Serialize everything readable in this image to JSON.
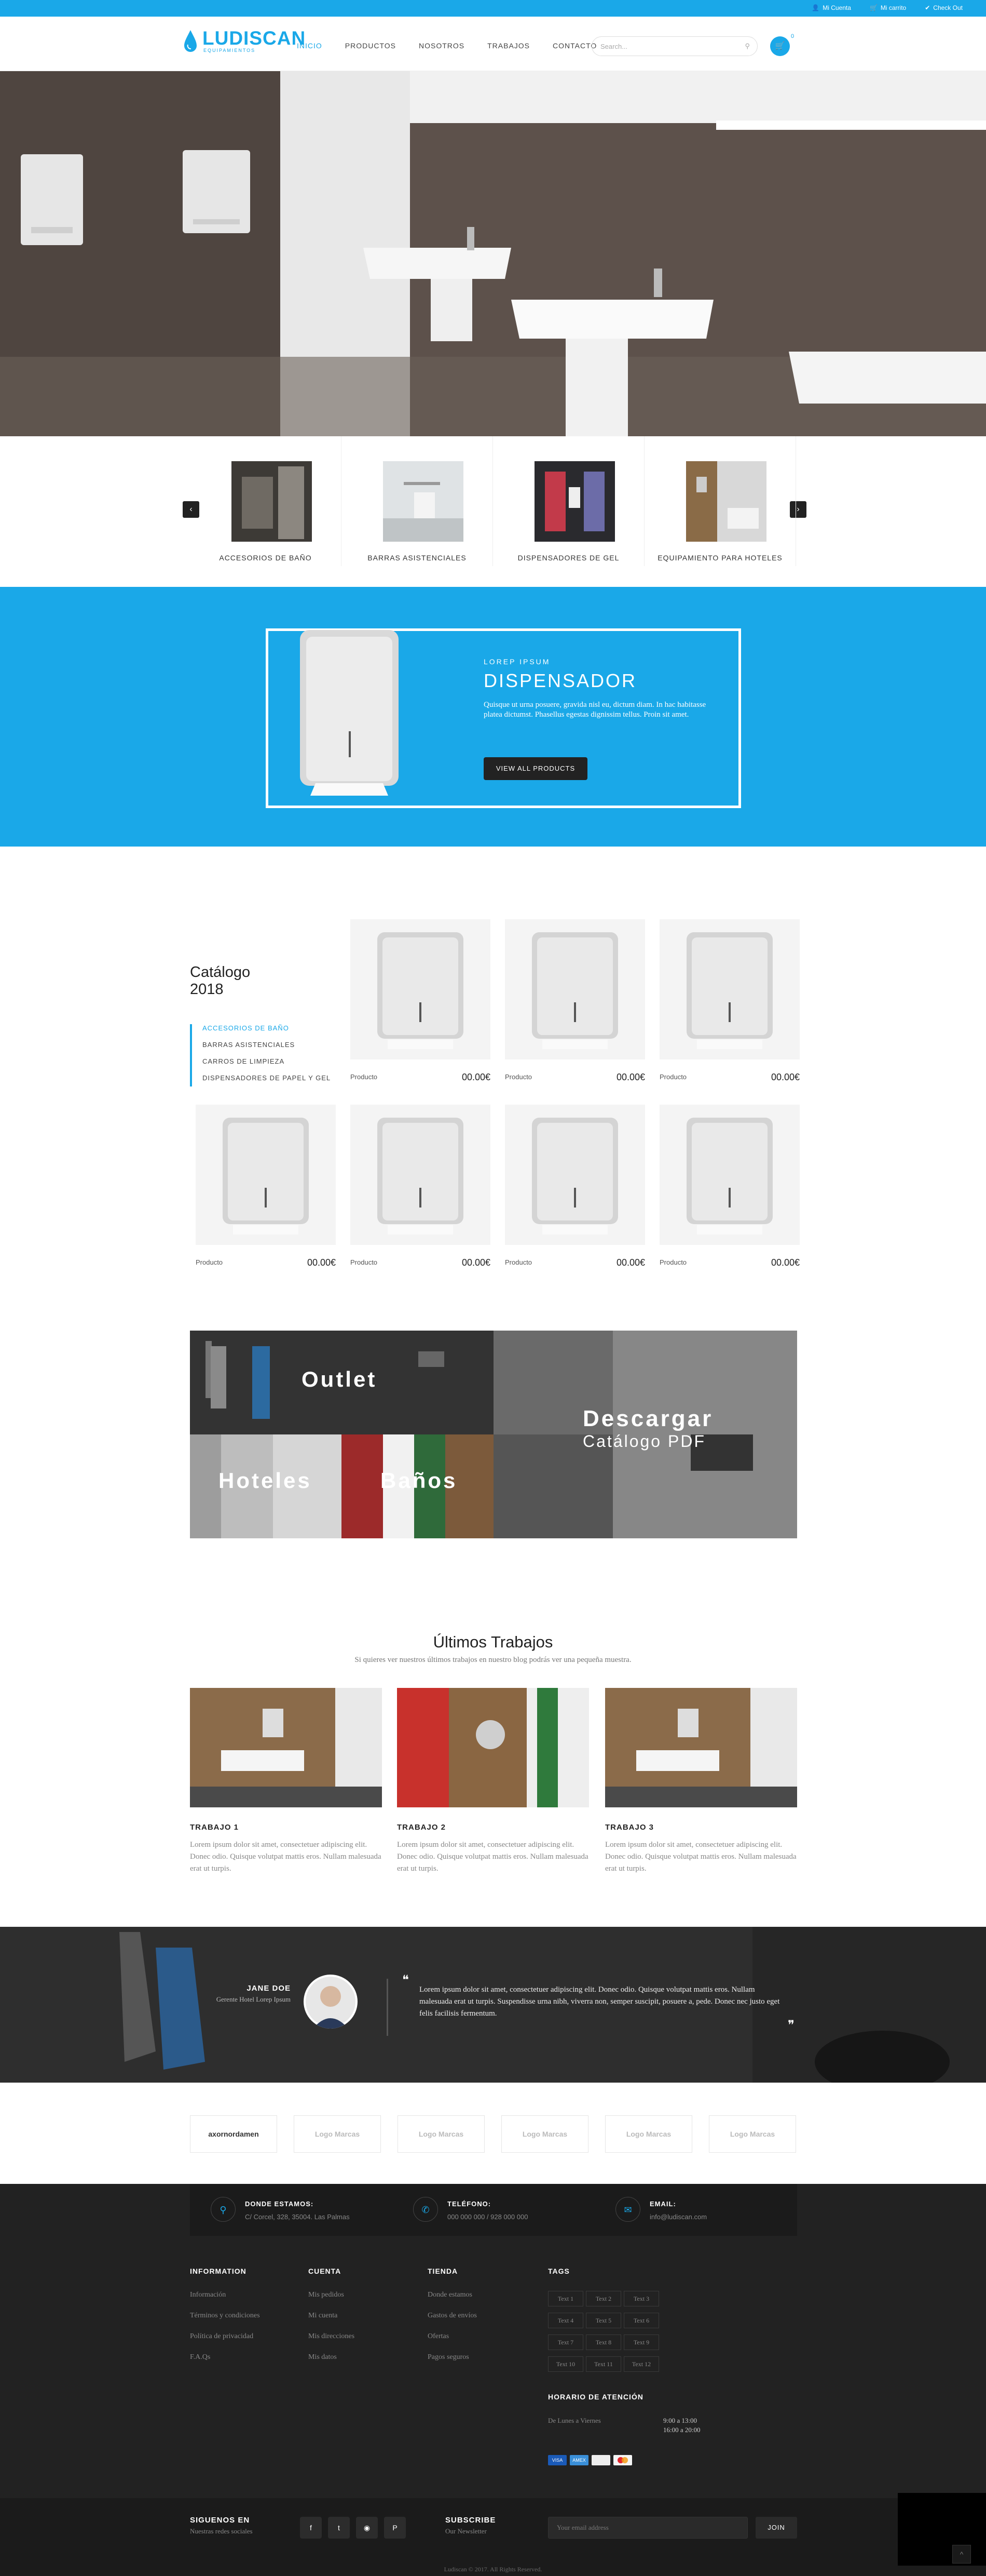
{
  "topbar": {
    "account": "Mi Cuenta",
    "cart": "Mi carrito",
    "checkout": "Check Out"
  },
  "header": {
    "logo_name": "LUDISCAN",
    "logo_sub": "EQUIPAMIENTOS",
    "nav": [
      "INICIO",
      "PRODUCTOS",
      "NOSOTROS",
      "TRABAJOS",
      "CONTACTO"
    ],
    "search_placeholder": "Search...",
    "cart_count": "0"
  },
  "categories": [
    "ACCESORIOS DE BAÑO",
    "BARRAS ASISTENCIALES",
    "DISPENSADORES DE GEL",
    "EQUIPAMIENTO PARA HOTELES"
  ],
  "promo": {
    "kicker": "LOREP IPSUM",
    "title": "DISPENSADOR",
    "text": "Quisque ut urna posuere, gravida nisl eu, dictum diam. In hac habitasse platea dictumst. Phasellus egestas dignissim tellus. Proin sit amet.",
    "button": "VIEW ALL PRODUCTS"
  },
  "catalog": {
    "title_line1": "Catálogo",
    "title_line2": "2018",
    "list": [
      "ACCESORIOS DE BAÑO",
      "BARRAS ASISTENCIALES",
      "CARROS DE LIMPIEZA",
      "DISPENSADORES DE PAPEL Y GEL"
    ],
    "products": [
      {
        "name": "Producto",
        "price": "00.00€"
      },
      {
        "name": "Producto",
        "price": "00.00€"
      },
      {
        "name": "Producto",
        "price": "00.00€"
      },
      {
        "name": "Producto",
        "price": "00.00€"
      },
      {
        "name": "Producto",
        "price": "00.00€"
      },
      {
        "name": "Producto",
        "price": "00.00€"
      },
      {
        "name": "Producto",
        "price": "00.00€"
      }
    ]
  },
  "banners": {
    "outlet": "Outlet",
    "hoteles": "Hoteles",
    "banos": "Baños",
    "download_line1": "Descargar",
    "download_line2": "Catálogo PDF"
  },
  "works": {
    "title": "Últimos Trabajos",
    "subtitle": "Si quieres ver nuestros últimos trabajos en nuestro blog podrás ver una pequeña muestra.",
    "items": [
      {
        "title": "TRABAJO 1",
        "text": "Lorem ipsum dolor sit amet, consectetuer adipiscing elit. Donec odio. Quisque volutpat mattis eros. Nullam malesuada erat ut turpis."
      },
      {
        "title": "TRABAJO 2",
        "text": "Lorem ipsum dolor sit amet, consectetuer adipiscing elit. Donec odio. Quisque volutpat mattis eros. Nullam malesuada erat ut turpis."
      },
      {
        "title": "TRABAJO 3",
        "text": "Lorem ipsum dolor sit amet, consectetuer adipiscing elit. Donec odio. Quisque volutpat mattis eros. Nullam malesuada erat ut turpis."
      }
    ]
  },
  "testimonial": {
    "name": "JANE DOE",
    "role": "Gerente Hotel Lorep Ipsum",
    "quote": "Lorem ipsum dolor sit amet, consectetuer adipiscing elit. Donec odio. Quisque volutpat mattis eros. Nullam malesuada erat ut turpis. Suspendisse urna nibh, viverra non, semper suscipit, posuere a, pede. Donec nec justo eget felis facilisis fermentum."
  },
  "brands": [
    "axornordamen",
    "Logo Marcas",
    "Logo Marcas",
    "Logo Marcas",
    "Logo Marcas",
    "Logo Marcas"
  ],
  "footer": {
    "contact": [
      {
        "title": "DONDE ESTAMOS:",
        "text": "C/ Corcel, 328, 35004. Las Palmas"
      },
      {
        "title": "TELÉFONO:",
        "text": "000 000 000 / 928 000 000"
      },
      {
        "title": "EMAIL:",
        "text": "info@ludiscan.com"
      }
    ],
    "information": {
      "title": "INFORMATION",
      "links": [
        "Información",
        "Términos y condiciones",
        "Política de privacidad",
        "F.A.Qs"
      ]
    },
    "account": {
      "title": "CUENTA",
      "links": [
        "Mis pedidos",
        "Mi cuenta",
        "Mis direcciones",
        "Mis datos"
      ]
    },
    "shop": {
      "title": "TIENDA",
      "links": [
        "Donde estamos",
        "Gastos de envíos",
        "Ofertas",
        "Pagos seguros"
      ]
    },
    "tags": {
      "title": "TAGS",
      "items": [
        "Text 1",
        "Text 2",
        "Text 3",
        "Text 4",
        "Text 5",
        "Text 6",
        "Text 7",
        "Text 8",
        "Text 9",
        "Text 10",
        "Text 11",
        "Text 12"
      ]
    },
    "hours": {
      "title": "HORARIO DE ATENCIÓN",
      "days": "De Lunes a Viernes",
      "slot1": "9:00 a 13:00",
      "slot2": "16:00 a 20:00"
    },
    "follow": {
      "title": "SIGUENOS EN",
      "subtitle": "Nuestras redes sociales"
    },
    "subscribe": {
      "title": "SUBSCRIBE",
      "subtitle": "Our Newsletter",
      "placeholder": "Your email address",
      "button": "JOIN"
    },
    "copyright": "Ludiscan © 2017. All Rights Reserved."
  },
  "colors": {
    "accent": "#1aa8e8",
    "dark": "#222222"
  }
}
